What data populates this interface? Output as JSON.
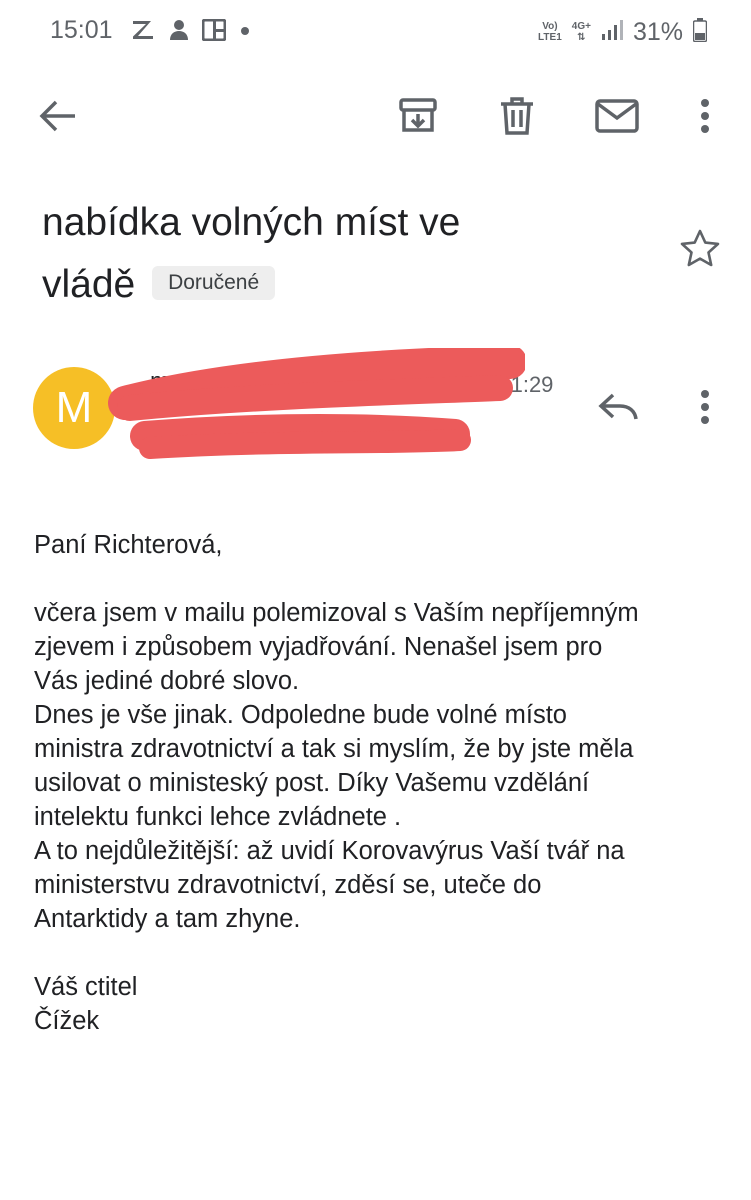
{
  "status_bar": {
    "time": "15:01",
    "net_top": "Vo)",
    "net_bottom": "LTE1",
    "net_4g": "4G+",
    "battery": "31%"
  },
  "toolbar": {
    "icons": [
      "back-arrow-icon",
      "archive-icon",
      "delete-icon",
      "mark-unread-icon",
      "more-vert-icon"
    ]
  },
  "email": {
    "subject_line1": "nabídka volných míst ve",
    "subject_line2": "vládě",
    "label": "Doručené",
    "avatar_letter": "M",
    "sender_name": "mp…",
    "sender_sub": "…a richter…",
    "time": "11:29",
    "redaction_color": "#ec5b5b",
    "body": [
      "Paní Richterová,",
      "",
      "včera jsem v mailu polemizoval s Vaším nepříjemným",
      "zjevem i způsobem vyjadřování. Nenašel jsem pro",
      "Vás jediné dobré slovo.",
      "Dnes je vše jinak. Odpoledne bude volné místo",
      "ministra zdravotnictví a tak si myslím, že by jste měla",
      "usilovat o ministeský post. Díky Vašemu vzdělání",
      "intelektu  funkci lehce zvládnete .",
      "A to nejdůležitější: až uvidí Korovavýrus Vaší tvář na",
      "ministerstvu zdravotnictví, zděsí se,  uteče do",
      "Antarktidy a tam zhyne.",
      "",
      "Váš ctitel",
      "Čížek"
    ]
  }
}
